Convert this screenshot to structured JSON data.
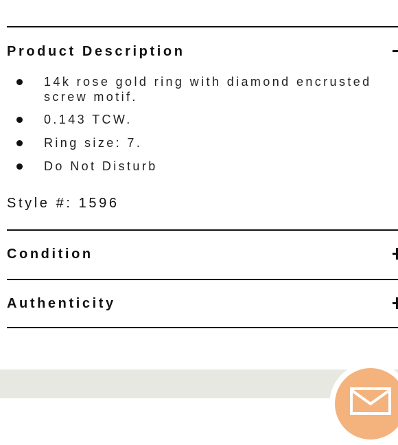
{
  "sections": {
    "description": {
      "title": "Product Description",
      "bullets": [
        "14k rose gold ring with diamond encrusted\nscrew motif.",
        "0.143 TCW.",
        "Ring size: 7.",
        "Do Not Disturb"
      ],
      "style_label": "Style #: 1596"
    },
    "condition": {
      "title": "Condition"
    },
    "authenticity": {
      "title": "Authenticity"
    }
  },
  "icons": {
    "toggle": "plus-icon",
    "contact": "mail-icon"
  },
  "colors": {
    "text": "#111111",
    "footer_band": "#e8e8e3",
    "contact_button": "#f4b27d"
  }
}
